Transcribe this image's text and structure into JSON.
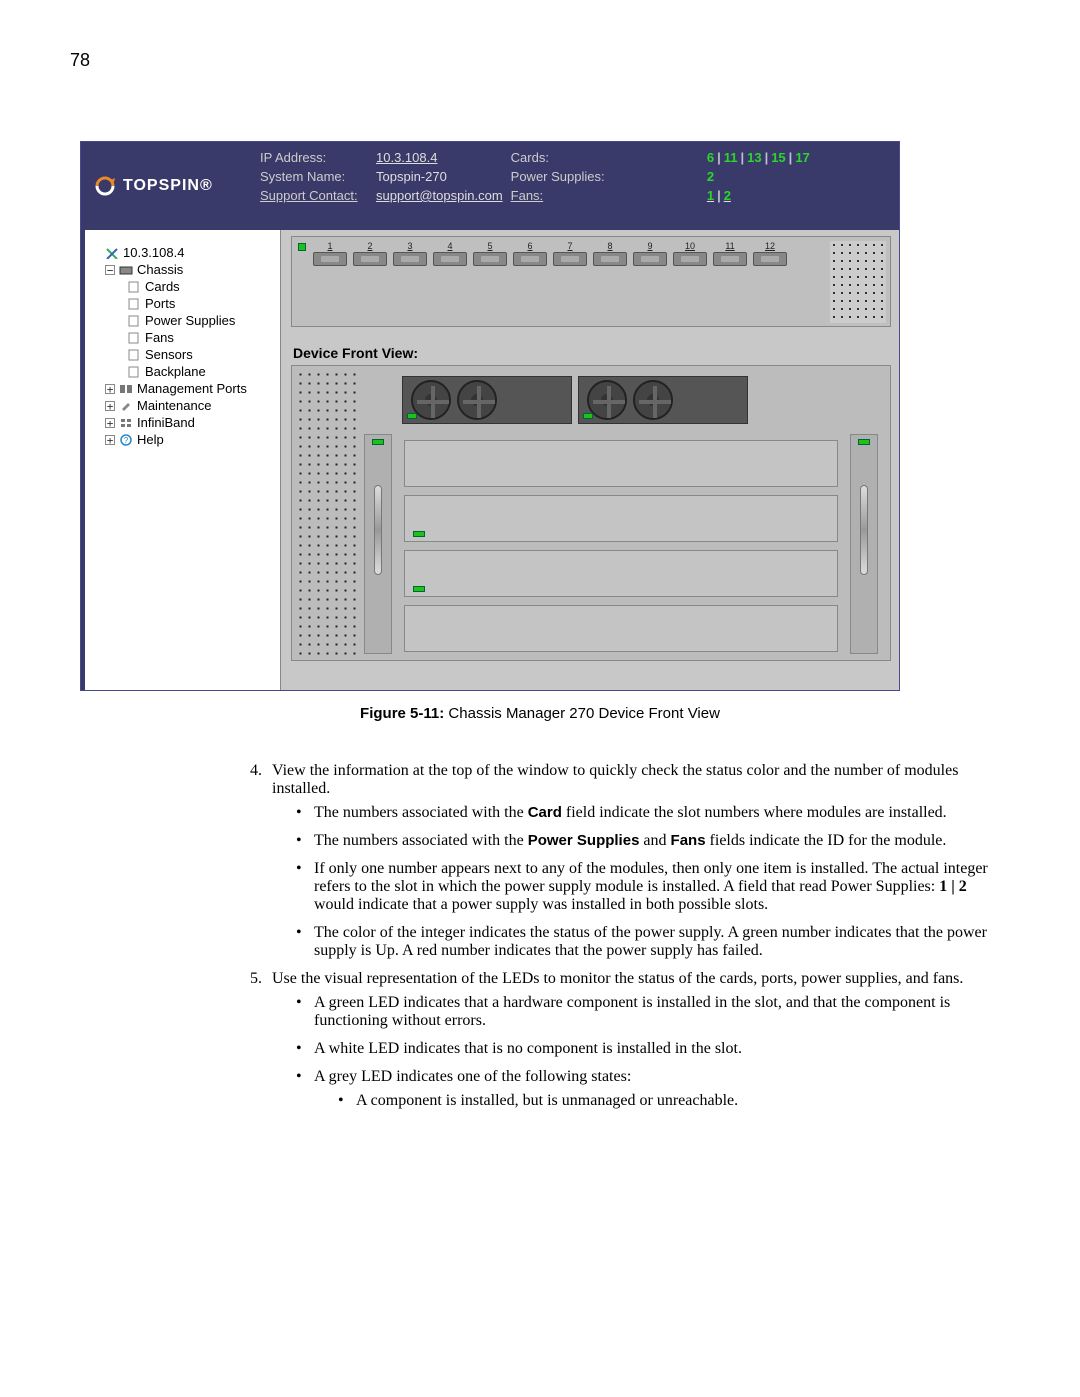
{
  "page_number": "78",
  "header": {
    "brand": "TOPSPIN",
    "ip_label": "IP Address:",
    "ip_value": "10.3.108.4",
    "sysname_label": "System Name:",
    "sysname_value": "Topspin-270",
    "support_label": "Support Contact:",
    "support_value": "support@topspin.com",
    "cards_label": "Cards:",
    "cards_values": [
      "6",
      "11",
      "13",
      "15",
      "17"
    ],
    "ps_label": "Power Supplies:",
    "ps_value": "2",
    "fans_label": "Fans:",
    "fans_values": [
      "1",
      "2"
    ]
  },
  "tree": {
    "root": "10.3.108.4",
    "chassis": "Chassis",
    "cards": "Cards",
    "ports": "Ports",
    "power_supplies": "Power Supplies",
    "fans": "Fans",
    "sensors": "Sensors",
    "backplane": "Backplane",
    "mgmt_ports": "Management Ports",
    "maintenance": "Maintenance",
    "infiniband": "InfiniBand",
    "help": "Help"
  },
  "rear_slots": [
    "1",
    "2",
    "3",
    "4",
    "5",
    "6",
    "7",
    "8",
    "9",
    "10",
    "11",
    "12"
  ],
  "front_title": "Device Front View:",
  "figure": {
    "label": "Figure 5-11:",
    "caption": "Chassis Manager 270 Device Front View"
  },
  "body": {
    "item4": "View the information at the top of the window to quickly check the status color and the number of modules installed.",
    "b4_1a": "The numbers associated with the ",
    "b4_1b": "Card",
    "b4_1c": " field indicate the slot numbers where modules are installed.",
    "b4_2a": "The numbers associated with the ",
    "b4_2b": "Power Supplies",
    "b4_2c": " and ",
    "b4_2d": "Fans",
    "b4_2e": " fields indicate the ID for the module.",
    "b4_3a": "If only one number appears next to any of the modules, then only one item is installed. The actual integer refers to the slot in which the power supply module is installed. A field that read Power Supplies: ",
    "b4_3b": "1 | 2",
    "b4_3c": " would indicate that a power supply was installed in both possible slots.",
    "b4_4": "The color of the integer indicates the status of the power supply. A green number indicates that the power supply is Up. A red number indicates that the power supply has failed.",
    "item5": "Use the visual representation of the LEDs to monitor the status of the cards, ports, power supplies, and fans.",
    "b5_1": "A green LED indicates that a hardware component is installed in the slot, and that the component is functioning without errors.",
    "b5_2": "A white LED indicates that is no component is installed in the slot.",
    "b5_3": "A grey LED indicates one of the following states:",
    "b5_3_1": "A component is installed, but is unmanaged or unreachable."
  }
}
